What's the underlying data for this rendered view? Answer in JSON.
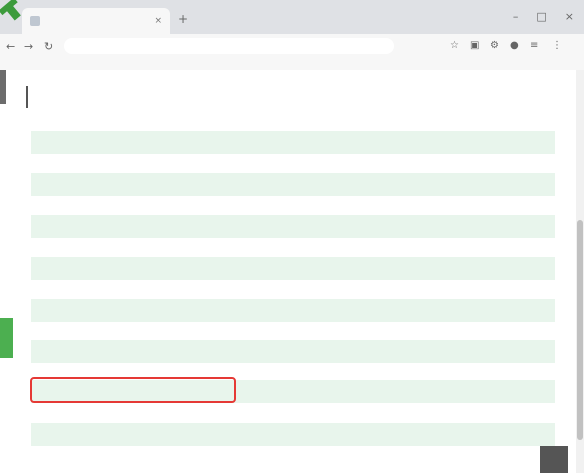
{
  "browser": {
    "tab_title": "",
    "tab_close": "×",
    "new_tab": "+",
    "window_controls": {
      "minimize": "–",
      "maximize": "□",
      "close": "×"
    },
    "nav": {
      "back": "←",
      "forward": "→",
      "reload": "↻"
    },
    "url": "",
    "extensions": [
      "☆",
      "▣",
      "⚙",
      "●",
      "≡",
      "⋮"
    ],
    "bookmarks": [
      "",
      "",
      "",
      ""
    ]
  },
  "page": {
    "section_title": "",
    "items": [
      {
        "label": ""
      },
      {
        "label": ""
      },
      {
        "label": ""
      },
      {
        "label": ""
      },
      {
        "label": ""
      },
      {
        "label": ""
      },
      {
        "label": ""
      },
      {
        "label": ""
      }
    ],
    "highlighted_index": 6,
    "to_top_label": "",
    "colors": {
      "row_bg": "#e8f5ec",
      "highlight_border": "#e53935",
      "indicator_green": "#4caf50"
    }
  }
}
